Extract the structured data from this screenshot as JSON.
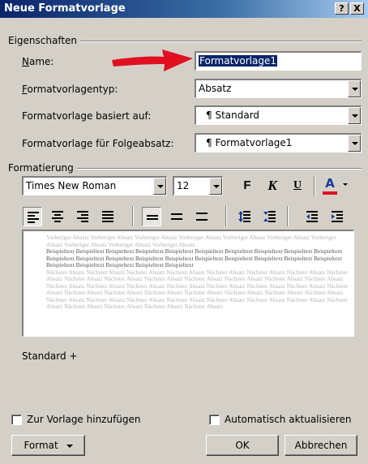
{
  "window": {
    "title": "Neue Formatvorlage",
    "help_label": "?",
    "close_label": "X"
  },
  "properties": {
    "group_label": "Eigenschaften",
    "name_label": "Name:",
    "name_value": "Formatvorlage1",
    "type_label": "Formatvorlagentyp:",
    "type_value": "Absatz",
    "based_on_label": "Formatvorlage basiert auf:",
    "based_on_value": "¶ Standard",
    "next_label": "Formatvorlage für Folgeabsatz:",
    "next_value": "¶ Formatvorlage1"
  },
  "formatting": {
    "group_label": "Formatierung",
    "font": "Times New Roman",
    "size": "12",
    "bold": "F",
    "italic": "K",
    "underline": "U",
    "color": "A"
  },
  "preview": {
    "prev_text": "Vorheriger Absatz Vorheriger Absatz Vorheriger Absatz Vorheriger Absatz Vorheriger Absatz Vorheriger Absatz Vorheriger Absatz Vorheriger Absatz Vorheriger Absatz Vorheriger Absatz",
    "current_text": "Beispieltext Beispieltext Beispieltext Beispieltext Beispieltext Beispieltext Beispieltext Beispieltext Beispieltext Beispieltext Beispieltext Beispieltext Beispieltext Beispieltext Beispieltext Beispieltext Beispieltext Beispieltext Beispieltext Beispieltext Beispieltext Beispieltext Beispieltext Beispieltext Beispieltext",
    "next_text": "Nächster Absatz Nächster Absatz Nächster Absatz Nächster Absatz Nächster Absatz Nächster Absatz Nächster Absatz Nächster Absatz Nächster Absatz Nächster Absatz Nächster Absatz Nächster Absatz Nächster Absatz Nächster Absatz Nächster Absatz Nächster Absatz Nächster Absatz Nächster Absatz Nächster Absatz Nächster Absatz Nächster Absatz Nächster Absatz Nächster Absatz Nächster Absatz Nächster Absatz Nächster Absatz Nächster Absatz Nächster Absatz Nächster Absatz Nächster Absatz Nächster Absatz Nächster Absatz Nächster Absatz Nächster Absatz Nächster Absatz Nächster Absatz Nächster Absatz Nächster Absatz Nächster Absatz Nächster Absatz Nächster Absatz Nächster Absatz"
  },
  "description": "Standard +",
  "footer": {
    "add_to_template": "Zur Vorlage hinzufügen",
    "auto_update": "Automatisch aktualisieren",
    "format_button": "Format",
    "ok_button": "OK",
    "cancel_button": "Abbrechen"
  },
  "colors": {
    "title_bar": "#0a246a",
    "dialog_bg": "#d4d0c8",
    "selection": "#0a246a",
    "annotation_arrow": "#e01020",
    "font_color_bar": "#e01020"
  }
}
